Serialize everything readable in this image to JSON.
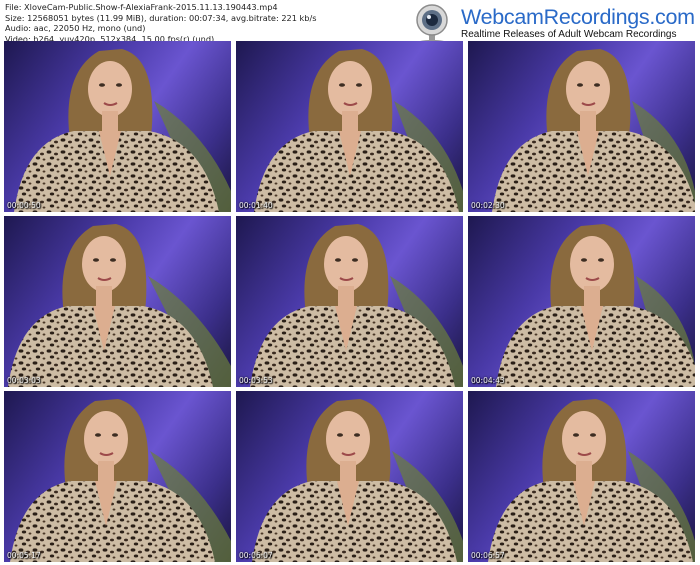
{
  "file_info": {
    "line1": "File: XloveCam-Public.Show-f-AlexiaFrank-2015.11.13.190443.mp4",
    "line2": "Size: 12568051 bytes (11.99 MiB), duration: 00:07:34, avg.bitrate: 221 kb/s",
    "line3": "Audio: aac, 22050 Hz, mono (und)",
    "line4": "Video: h264, yuv420p, 512x384, 15.00 fps(r) (und)"
  },
  "brand": {
    "site": "WebcamRecordings.com",
    "tagline": "Realtime Releases of Adult Webcam Recordings",
    "logo_icon": "webcam-icon"
  },
  "thumbnails": [
    {
      "timestamp": "00:00:50"
    },
    {
      "timestamp": "00:01:40"
    },
    {
      "timestamp": "00:02:30"
    },
    {
      "timestamp": "00:03:03"
    },
    {
      "timestamp": "00:03:53"
    },
    {
      "timestamp": "00:04:43"
    },
    {
      "timestamp": "00:05:17"
    },
    {
      "timestamp": "00:06:07"
    },
    {
      "timestamp": "00:06:57"
    }
  ]
}
